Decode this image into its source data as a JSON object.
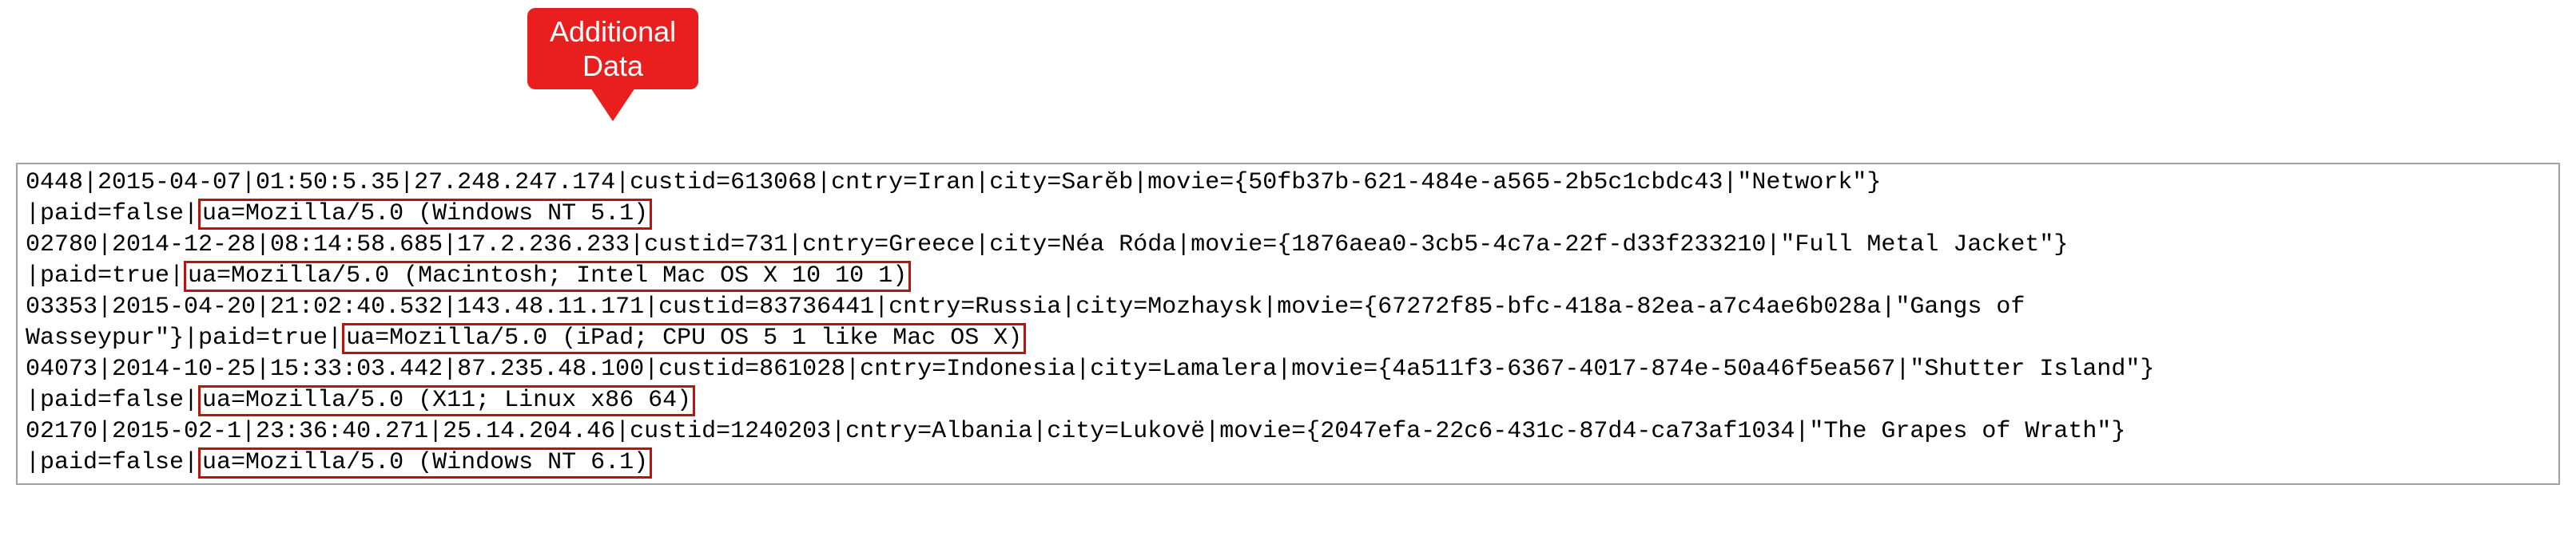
{
  "callout": {
    "line1": "Additional",
    "line2": "Data"
  },
  "log": {
    "entries": [
      {
        "pre": "0448|2015-04-07|01:50:5.35|27.248.247.174|custid=613068|cntry=Iran|city=Sarĕb|movie={50fb37b-621-484e-a565-2b5c1cbdc43|\"Network\"}",
        "paid_prefix": "|paid=false|",
        "ua": "ua=Mozilla/5.0 (Windows NT 5.1)"
      },
      {
        "pre": "02780|2014-12-28|08:14:58.685|17.2.236.233|custid=731|cntry=Greece|city=Néa Róda|movie={1876aea0-3cb5-4c7a-22f-d33f233210|\"Full Metal Jacket\"}",
        "paid_prefix": "|paid=true|",
        "ua": "ua=Mozilla/5.0 (Macintosh; Intel Mac OS X 10 10 1)"
      },
      {
        "pre": "03353|2015-04-20|21:02:40.532|143.48.11.171|custid=83736441|cntry=Russia|city=Mozhaysk|movie={67272f85-bfc-418a-82ea-a7c4ae6b028a|\"Gangs of",
        "pre2": "Wasseypur\"}|paid=true|",
        "ua": "ua=Mozilla/5.0 (iPad; CPU OS 5 1 like Mac OS X)"
      },
      {
        "pre": "04073|2014-10-25|15:33:03.442|87.235.48.100|custid=861028|cntry=Indonesia|city=Lamalera|movie={4a511f3-6367-4017-874e-50a46f5ea567|\"Shutter Island\"}",
        "paid_prefix": "|paid=false|",
        "ua": "ua=Mozilla/5.0 (X11; Linux x86 64)"
      },
      {
        "pre": "02170|2015-02-1|23:36:40.271|25.14.204.46|custid=1240203|cntry=Albania|city=Lukovë|movie={2047efa-22c6-431c-87d4-ca73af1034|\"The Grapes of Wrath\"}",
        "paid_prefix": "|paid=false|",
        "ua": "ua=Mozilla/5.0 (Windows NT 6.1)"
      }
    ]
  }
}
